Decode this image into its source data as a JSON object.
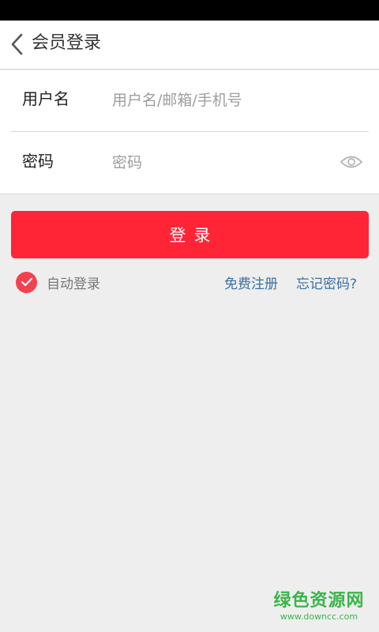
{
  "header": {
    "back_icon": "chevron-left-icon",
    "title": "会员登录"
  },
  "form": {
    "username": {
      "label": "用户名",
      "placeholder": "用户名/邮箱/手机号",
      "value": ""
    },
    "password": {
      "label": "密码",
      "placeholder": "密码",
      "value": "",
      "toggle_icon": "eye-icon"
    }
  },
  "login_button": {
    "label": "登录"
  },
  "options": {
    "auto_login_label": "自动登录",
    "auto_login_checked": true,
    "register_link": "免费注册",
    "forgot_link": "忘记密码?"
  },
  "watermark": {
    "title": "绿色资源网",
    "url": "www.downcc.com"
  },
  "colors": {
    "accent": "#ff2436",
    "checkbox": "#f3414e",
    "link": "#3a6fa3",
    "background": "#eeeeee",
    "watermark": "#39b54a"
  }
}
